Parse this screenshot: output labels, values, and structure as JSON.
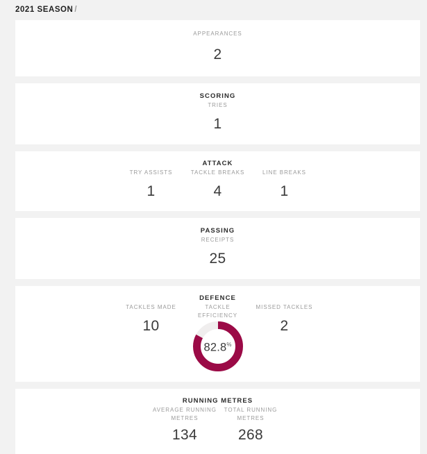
{
  "header": {
    "season_label": "2021 SEASON",
    "separator": "/"
  },
  "theme": {
    "accent": "#9b0a46",
    "track": "#f0eeee",
    "page_background": "#f2f2f2",
    "card_background": "#ffffff",
    "label_color": "#9b9b9b",
    "value_color": "#3a3a3a"
  },
  "sections": {
    "appearances": {
      "label": "APPEARANCES",
      "value": "2"
    },
    "scoring": {
      "title": "SCORING",
      "label": "TRIES",
      "value": "1"
    },
    "attack": {
      "title": "ATTACK",
      "stats": [
        {
          "label": "TRY ASSISTS",
          "value": "1"
        },
        {
          "label": "TACKLE BREAKS",
          "value": "4"
        },
        {
          "label": "LINE BREAKS",
          "value": "1"
        }
      ]
    },
    "passing": {
      "title": "PASSING",
      "label": "RECEIPTS",
      "value": "25"
    },
    "defence": {
      "title": "DEFENCE",
      "tackles_made": {
        "label": "TACKLES MADE",
        "value": "10"
      },
      "tackle_efficiency": {
        "label": "TACKLE EFFICIENCY",
        "value": "82.8",
        "unit": "%",
        "percent": 82.8
      },
      "missed_tackles": {
        "label": "MISSED TACKLES",
        "value": "2"
      }
    },
    "running_metres": {
      "title": "RUNNING METRES",
      "stats": [
        {
          "label": "AVERAGE RUNNING METRES",
          "value": "134"
        },
        {
          "label": "TOTAL RUNNING METRES",
          "value": "268"
        }
      ]
    }
  },
  "chart_data": {
    "type": "pie",
    "title": "TACKLE EFFICIENCY",
    "categories": [
      "Tackle efficiency",
      "Remainder"
    ],
    "values": [
      82.8,
      17.2
    ],
    "value_label": "82.8%",
    "colors": [
      "#9b0a46",
      "#f0eeee"
    ],
    "ylim": [
      0,
      100
    ],
    "legend": "none",
    "grid": false
  }
}
